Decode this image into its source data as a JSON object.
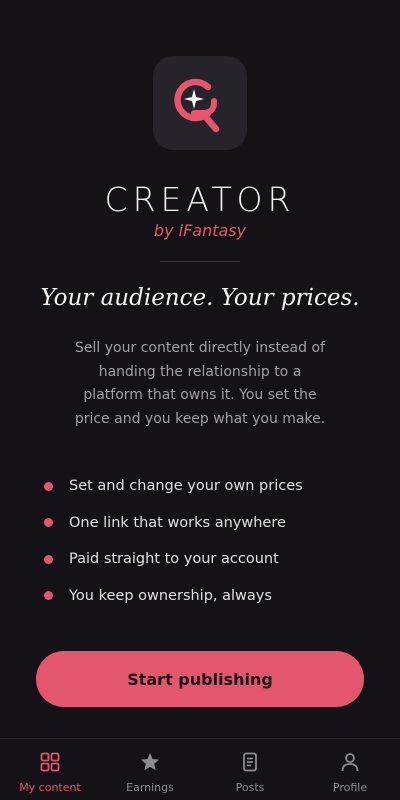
{
  "brand": {
    "name": "CREATOR",
    "byline": "by iFantasy"
  },
  "hero": {
    "tagline": "Your audience. Your prices.",
    "description": "Sell your content directly instead of handing the relationship to a platform that owns it. You set the price and you keep what you make."
  },
  "features": [
    "Set and change your own prices",
    "One link that works anywhere",
    "Paid straight to your account",
    "You keep ownership, always"
  ],
  "cta": {
    "label": "Start publishing"
  },
  "tabs": [
    {
      "label": "My content",
      "icon": "grid-icon",
      "active": true
    },
    {
      "label": "Earnings",
      "icon": "star-icon",
      "active": false
    },
    {
      "label": "Posts",
      "icon": "document-icon",
      "active": false
    },
    {
      "label": "Profile",
      "icon": "person-icon",
      "active": false
    }
  ],
  "colors": {
    "background": "#151217",
    "accent": "#e5566e",
    "icon_tile": "#26232b",
    "muted_text": "#a39ea3"
  }
}
